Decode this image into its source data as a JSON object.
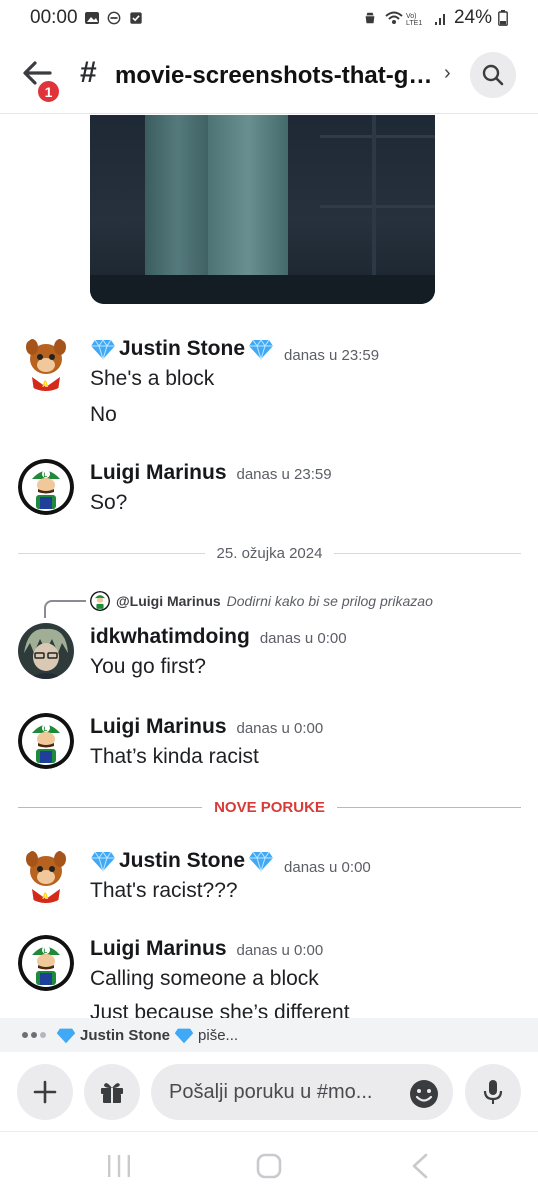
{
  "status_bar": {
    "time": "00:00",
    "battery": "24%"
  },
  "header": {
    "back_badge": "1",
    "channel_hash": "#",
    "channel_name": "movie-screenshots-that-go...",
    "chevron": "›"
  },
  "messages": [
    {
      "author": "Justin Stone",
      "time": "danas u 23:59",
      "lines": [
        "She's a block",
        "No"
      ]
    },
    {
      "author": "Luigi Marinus",
      "time": "danas u 23:59",
      "lines": [
        "So?"
      ]
    },
    {
      "reply_to": "@Luigi Marinus",
      "reply_text": "Dodirni kako bi se prilog prikazao",
      "author": "idkwhatimdoing",
      "time": "danas u 0:00",
      "lines": [
        "You go first?"
      ]
    },
    {
      "author": "Luigi Marinus",
      "time": "danas u 0:00",
      "lines": [
        "That’s kinda racist"
      ]
    },
    {
      "author": "Justin Stone",
      "time": "danas u 0:00",
      "lines": [
        "That's racist???"
      ]
    },
    {
      "author": "Luigi Marinus",
      "time": "danas u 0:00",
      "lines": [
        "Calling someone a block",
        "Just because she’s different"
      ]
    }
  ],
  "dividers": {
    "date": "25. ožujka 2024",
    "new_messages": "NOVE PORUKE"
  },
  "typing": {
    "user": "Justin Stone",
    "suffix": "piše..."
  },
  "composer": {
    "placeholder": "Pošalji poruku u #mo..."
  },
  "colors": {
    "accent_red": "#d83b37",
    "badge_red": "#e0343a",
    "gem_blue": "#3fa9f5",
    "luigi_green": "#1f8a3a"
  },
  "icons": [
    "back-arrow-icon",
    "search-icon",
    "plus-icon",
    "gift-icon",
    "emoji-icon",
    "microphone-icon",
    "gem-icon",
    "recents-icon",
    "home-icon",
    "back-icon"
  ]
}
